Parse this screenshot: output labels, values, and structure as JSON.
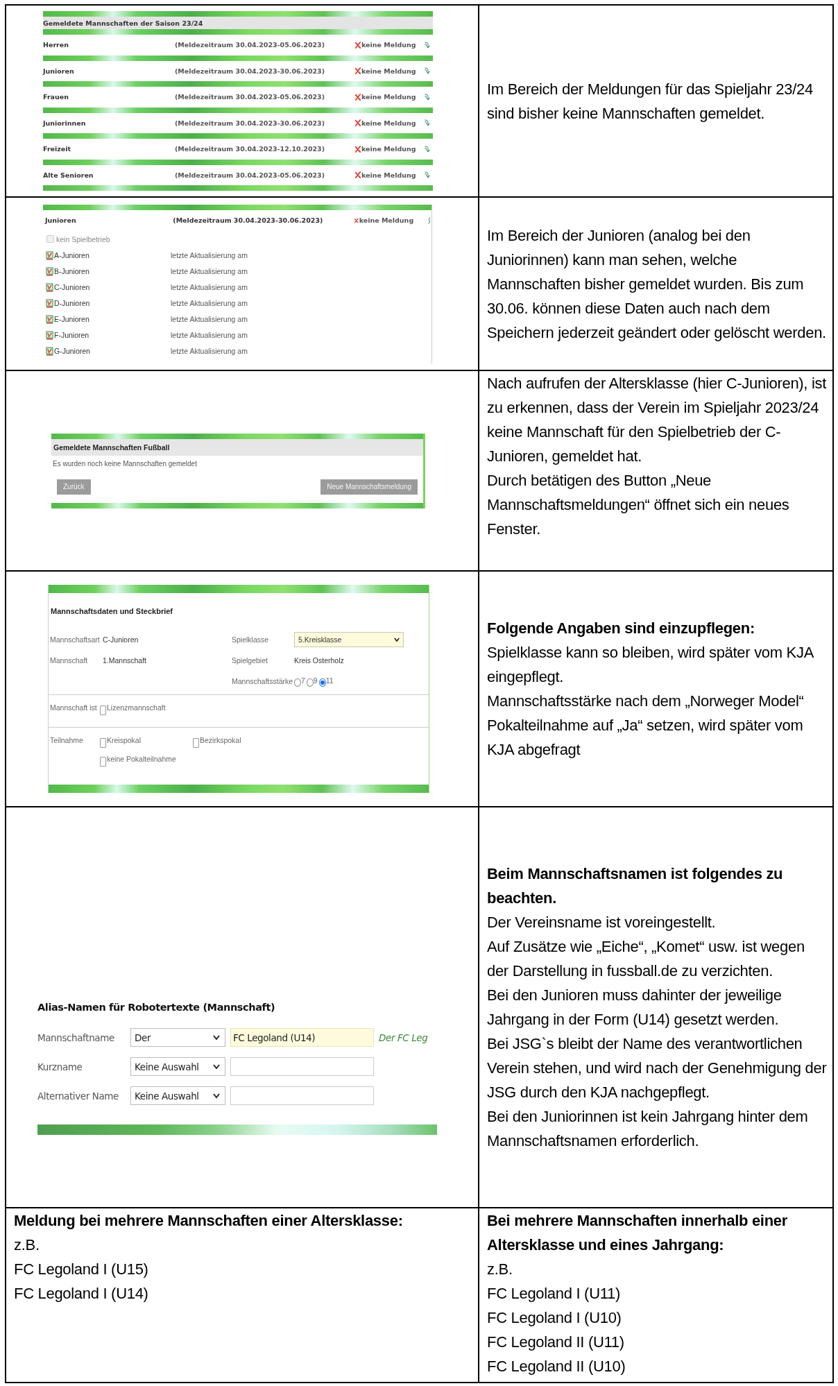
{
  "rows": [
    {
      "left": {
        "kind": "season_overview",
        "title": "Gemeldete Mannschaften der Saison 23/24",
        "items": [
          {
            "name": "Herren",
            "period": "(Meldezeitraum 30.04.2023-05.06.2023)",
            "status": "keine Meldung"
          },
          {
            "name": "Junioren",
            "period": "(Meldezeitraum 30.04.2023-30.06.2023)",
            "status": "keine Meldung"
          },
          {
            "name": "Frauen",
            "period": "(Meldezeitraum 30.04.2023-05.06.2023)",
            "status": "keine Meldung"
          },
          {
            "name": "Juniorinnen",
            "period": "(Meldezeitraum 30.04.2023-30.06.2023)",
            "status": "keine Meldung"
          },
          {
            "name": "Freizeit",
            "period": "(Meldezeitraum 30.04.2023-12.10.2023)",
            "status": "keine Meldung"
          },
          {
            "name": "Alte Senioren",
            "period": "(Meldezeitraum 30.04.2023-05.06.2023)",
            "status": "keine Meldung"
          }
        ]
      },
      "right": {
        "paragraphs": [
          "Im Bereich der Meldungen für das Spieljahr 23/24 sind bisher keine Mannschaften gemeldet."
        ]
      }
    },
    {
      "left": {
        "kind": "age_groups",
        "name": "Junioren",
        "period": "(Meldezeitraum 30.04.2023-30.06.2023)",
        "status": "keine Meldung",
        "no_play": {
          "label": "kein Spielbetrieb",
          "checked": false,
          "disabled": true
        },
        "items": [
          {
            "name": "A-Junioren",
            "update": "letzte Aktualisierung am"
          },
          {
            "name": "B-Junioren",
            "update": "letzte Aktualisierung am"
          },
          {
            "name": "C-Junioren",
            "update": "letzte Aktualisierung am"
          },
          {
            "name": "D-Junioren",
            "update": "letzte Aktualisierung am"
          },
          {
            "name": "E-Junioren",
            "update": "letzte Aktualisierung am"
          },
          {
            "name": "F-Junioren",
            "update": "letzte Aktualisierung am"
          },
          {
            "name": "G-Junioren",
            "update": "letzte Aktualisierung am"
          }
        ]
      },
      "right": {
        "paragraphs": [
          "Im Bereich der Junioren (analog bei den Juniorinnen) kann man sehen, welche Mannschaften bisher gemeldet wurden. Bis zum 30.06. können diese Daten auch nach dem Speichern jederzeit geändert oder gelöscht werden."
        ]
      }
    },
    {
      "left": {
        "kind": "team_list",
        "title": "Gemeldete Mannschaften Fußball",
        "message": "Es wurden noch keine Mannschaften gemeldet",
        "buttons": [
          "Zurück",
          "Neue Mannschaftsmeldung"
        ]
      },
      "right": {
        "paragraphs": [
          "Nach aufrufen der Altersklasse (hier C-Junioren), ist zu erkennen, dass der Verein im Spieljahr 2023/24 keine Mannschaft für den Spielbetrieb der C-Junioren, gemeldet hat.",
          "Durch betätigen des Button „Neue Mannschaftsmeldungen“ öffnet sich ein neues Fenster."
        ]
      }
    },
    {
      "left": {
        "kind": "team_form",
        "title": "Mannschaftsdaten und Steckbrief",
        "team_type": {
          "label": "Mannschaftsart",
          "value": "C-Junioren"
        },
        "team": {
          "label": "Mannschaft",
          "value": "1.Mannschaft"
        },
        "league": {
          "label": "Spielklasse",
          "value": "5.Kreisklasse"
        },
        "area": {
          "label": "Spielgebiet",
          "value": "Kreis Osterholz"
        },
        "strength": {
          "label": "Mannschaftsstärke",
          "options": [
            {
              "label": "7",
              "selected": false
            },
            {
              "label": "9",
              "selected": false
            },
            {
              "label": "11",
              "selected": true
            }
          ]
        },
        "team_is": {
          "label": "Mannschaft ist",
          "options": [
            {
              "label": "Lizenzmannschaft",
              "checked": false
            }
          ]
        },
        "participation": {
          "label": "Teilnahme",
          "options": [
            {
              "label": "Kreispokal",
              "checked": false
            },
            {
              "label": "Bezirkspokal",
              "checked": false
            },
            {
              "label": "keine Pokalteilnahme",
              "checked": false
            }
          ]
        }
      },
      "right": {
        "heading": "Folgende Angaben sind einzupflegen:",
        "paragraphs": [
          "Spielklasse kann so bleiben, wird später vom KJA eingepflegt.",
          "Mannschaftsstärke nach dem „Norweger Model“",
          "Pokalteilnahme auf „Ja“ setzen, wird später vom KJA abgefragt"
        ]
      }
    },
    {
      "left": {
        "kind": "alias_form",
        "title": "Alias-Namen für Robotertexte (Mannschaft)",
        "fields": [
          {
            "label": "Mannschaftname",
            "select": "Der",
            "value": "FC Legoland (U14)",
            "preview": "Der FC Leg"
          },
          {
            "label": "Kurzname",
            "select": "Keine Auswahl"
          },
          {
            "label": "Alternativer Name",
            "select": "Keine Auswahl"
          }
        ]
      },
      "right": {
        "heading": "Beim Mannschaftsnamen ist folgendes zu beachten.",
        "paragraphs": [
          "Der Vereinsname ist voreingestellt.",
          "Auf Zusätze wie „Eiche“, „Komet“ usw. ist wegen der Darstellung in fussball.de zu verzichten.",
          "Bei den Junioren muss dahinter der jeweilige Jahrgang in der Form (U14) gesetzt werden.",
          "Bei JSG`s bleibt der Name des verantwortlichen Verein stehen, und wird nach der Genehmigung der JSG durch den KJA nachgepflegt.",
          "Bei den Juniorinnen ist kein Jahrgang hinter dem Mannschaftsnamen erforderlich."
        ]
      }
    },
    {
      "left": {
        "kind": "text",
        "heading": "Meldung bei mehrere Mannschaften einer Altersklasse:",
        "paragraphs": [
          "z.B.",
          "FC Legoland I (U15)",
          "FC Legoland I (U14)"
        ]
      },
      "right": {
        "heading": "Bei mehrere Mannschaften innerhalb einer Altersklasse und eines Jahrgang:",
        "paragraphs": [
          "z.B.",
          "FC Legoland I (U11)",
          "FC Legoland I (U10)",
          "FC Legoland II (U11)",
          "FC Legoland II (U10)"
        ]
      }
    }
  ]
}
